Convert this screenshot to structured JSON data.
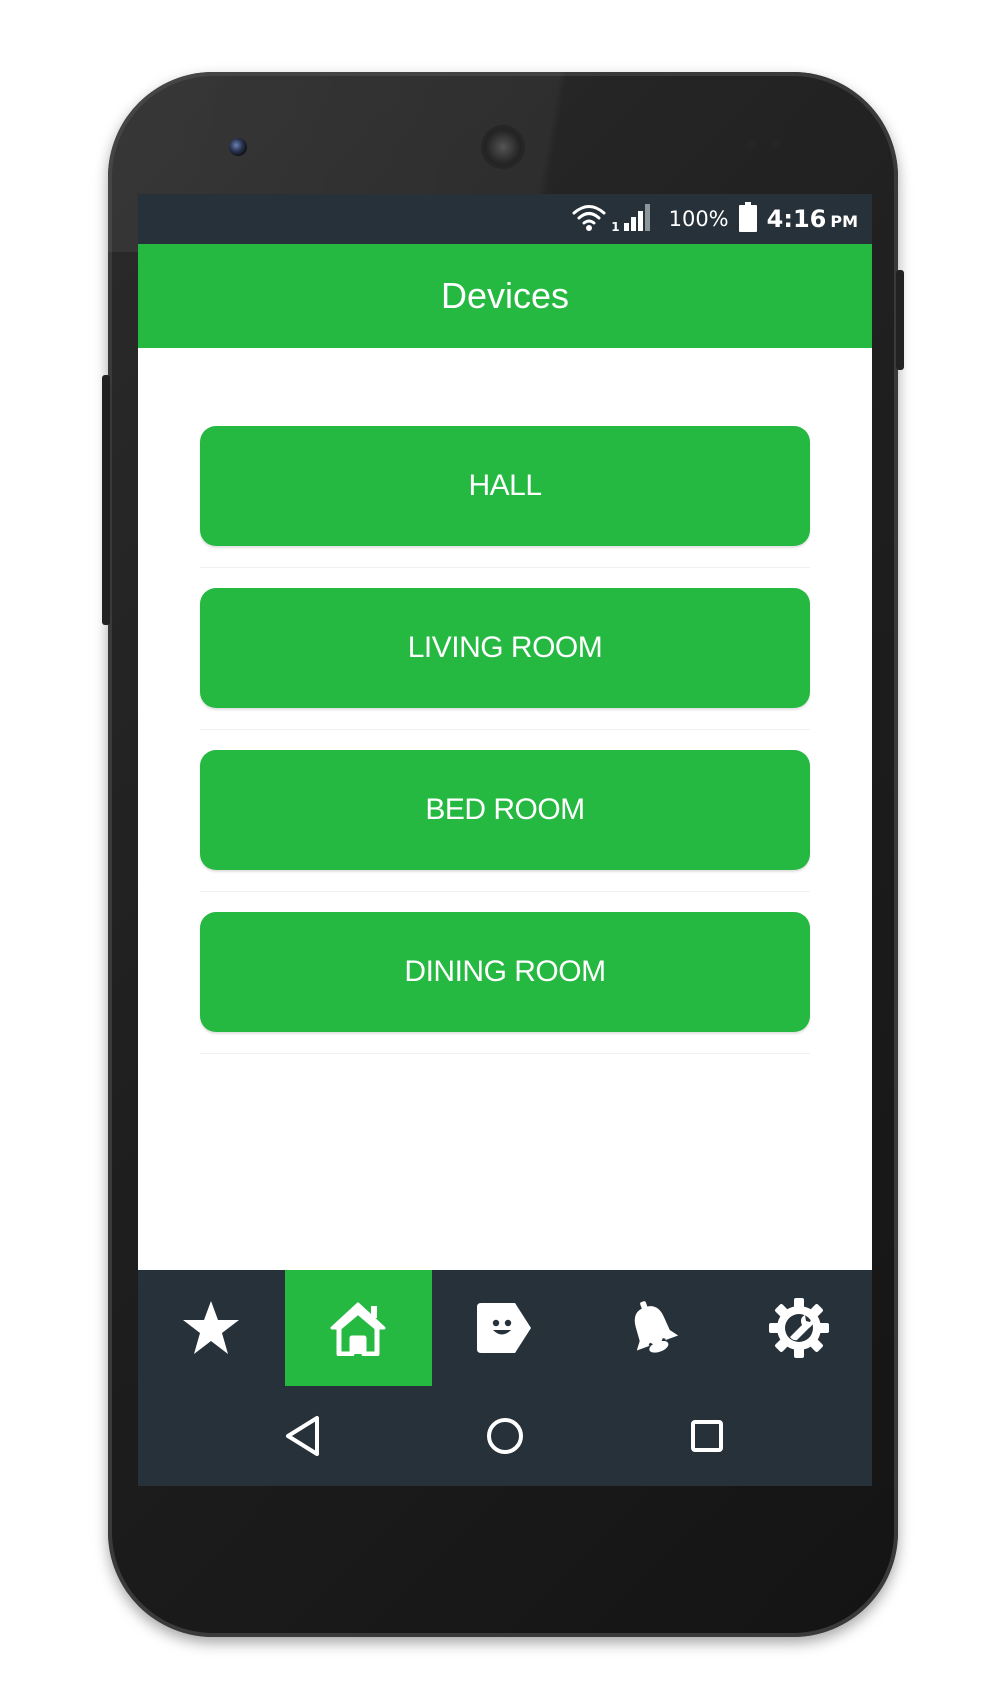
{
  "status_bar": {
    "network_badge": "1",
    "battery_percent": "100%",
    "time": "4:16",
    "ampm": "PM",
    "icons": [
      "wifi-icon",
      "cell-signal-icon",
      "battery-icon"
    ]
  },
  "app_bar": {
    "title": "Devices"
  },
  "devices": [
    {
      "label": "HALL"
    },
    {
      "label": "LIVING ROOM"
    },
    {
      "label": "BED ROOM"
    },
    {
      "label": "DINING ROOM"
    }
  ],
  "bottom_tabs": [
    {
      "icon": "star-icon",
      "active": false
    },
    {
      "icon": "home-icon",
      "active": true
    },
    {
      "icon": "tag-face-icon",
      "active": false
    },
    {
      "icon": "bell-icon",
      "active": false
    },
    {
      "icon": "gear-wrench-icon",
      "active": false
    }
  ],
  "nav_bar": {
    "icons": [
      "back-icon",
      "home-circle-icon",
      "recents-icon"
    ]
  },
  "colors": {
    "accent_green": "#25b942",
    "dark_bar": "#263139",
    "phone_body": "#1f1f1f",
    "text_on_accent": "#ffffff"
  }
}
